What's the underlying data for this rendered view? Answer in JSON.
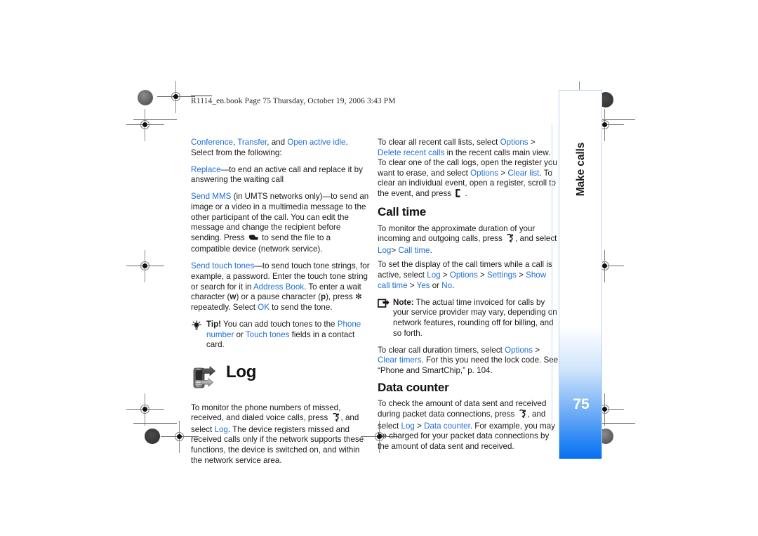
{
  "document": {
    "header_line": "R1114_en.book  Page 75  Thursday, October 19, 2006  3:43 PM",
    "page_number": "75",
    "margin_tab_label": "Make calls"
  },
  "left_column": {
    "para_conference": {
      "ui_conference": "Conference",
      "sep1": ", ",
      "ui_transfer": "Transfer",
      "sep2": ", and ",
      "ui_open_active_idle": "Open active idle",
      "rest": ". Select from the following:"
    },
    "para_replace": {
      "ui_replace": "Replace",
      "rest": "—to end an active call and replace it by answering the waiting call"
    },
    "para_send_mms": {
      "ui_send_mms": "Send MMS",
      "part1": " (in UMTS networks only)—to send an image or a video in a multimedia message to the other participant of the call. You can edit the message and change the recipient before sending. Press ",
      "part2": " to send the file to a compatible device (network service)."
    },
    "para_send_touch_tones": {
      "ui_send_touch_tones": "Send touch tones",
      "part1": "—to send touch tone strings, for example, a password. Enter the touch tone string or search for it in ",
      "ui_address_book": "Address Book",
      "part2": ". To enter a wait character (",
      "bold_w": "w",
      "part3": ") or a pause character (",
      "bold_p": "p",
      "part4": "), press ",
      "asterisk": "✻",
      "part5": " repeatedly. Select ",
      "ui_ok": "OK",
      "part6": " to send the tone."
    },
    "tip": {
      "label": "Tip!",
      "part1": " You can add touch tones to the ",
      "ui_phone_number": "Phone number",
      "part2": " or ",
      "ui_touch_tones": "Touch tones",
      "part3": " fields in a contact card."
    },
    "chapter": {
      "title": "Log",
      "icon": "log-phone-arrow-icon"
    },
    "para_log_intro": {
      "part1": "To monitor the phone numbers of missed, received, and dialed voice calls, press ",
      "part2": ", and select ",
      "ui_log": "Log",
      "part3": ". The device registers missed and received calls only if the network supports these functions, the device is switched on, and within the network service area."
    }
  },
  "right_column": {
    "para_clear_recent": {
      "part1": "To clear all recent call lists, select ",
      "ui_options": "Options",
      "gt1": " > ",
      "ui_delete_recent_calls": "Delete recent calls",
      "part2": " in the recent calls main view. To clear one of the call logs, open the register you want to erase, and select ",
      "ui_options2": "Options",
      "gt2": " > ",
      "ui_clear_list": "Clear list",
      "part3": ". To clear an individual event, open a register, scroll to the event, and press ",
      "part4": " ."
    },
    "heading_call_time": "Call time",
    "para_call_time_monitor": {
      "part1": "To monitor the approximate duration of your incoming and outgoing calls, press ",
      "part2": ", and select ",
      "ui_log": "Log",
      "gt": "> ",
      "ui_call_time": "Call time",
      "part3": "."
    },
    "para_call_time_settings": {
      "part1": "To set the display of the call timers while a call is active, select ",
      "ui_log": "Log",
      "gt1": " > ",
      "ui_options": "Options",
      "gt2": " > ",
      "ui_settings": "Settings",
      "gt3": " > ",
      "ui_show_call_time": "Show call time",
      "gt4": " > ",
      "ui_yes": "Yes",
      "part2": " or ",
      "ui_no": "No",
      "part3": "."
    },
    "note": {
      "label": "Note:",
      "text": " The actual time invoiced for calls by your service provider may vary, depending on network features, rounding off for billing, and so forth."
    },
    "para_clear_timers": {
      "part1": "To clear call duration timers, select ",
      "ui_options": "Options",
      "gt": " > ",
      "ui_clear_timers": "Clear timers",
      "part2": ". For this you need the lock code. See “Phone and SmartChip,” p. 104."
    },
    "heading_data_counter": "Data counter",
    "para_data_counter": {
      "part1": "To check the amount of data sent and received during packet data connections, press ",
      "part2": ", and select ",
      "ui_log": "Log",
      "gt": " > ",
      "ui_data_counter": "Data counter",
      "part3": ". For example, you may be charged for your packet data connections by the amount of data sent and received."
    }
  },
  "colors": {
    "ui_link": "#1f6fd4",
    "tab_blue": "#0a6ef0",
    "text": "#1a1a1a"
  }
}
